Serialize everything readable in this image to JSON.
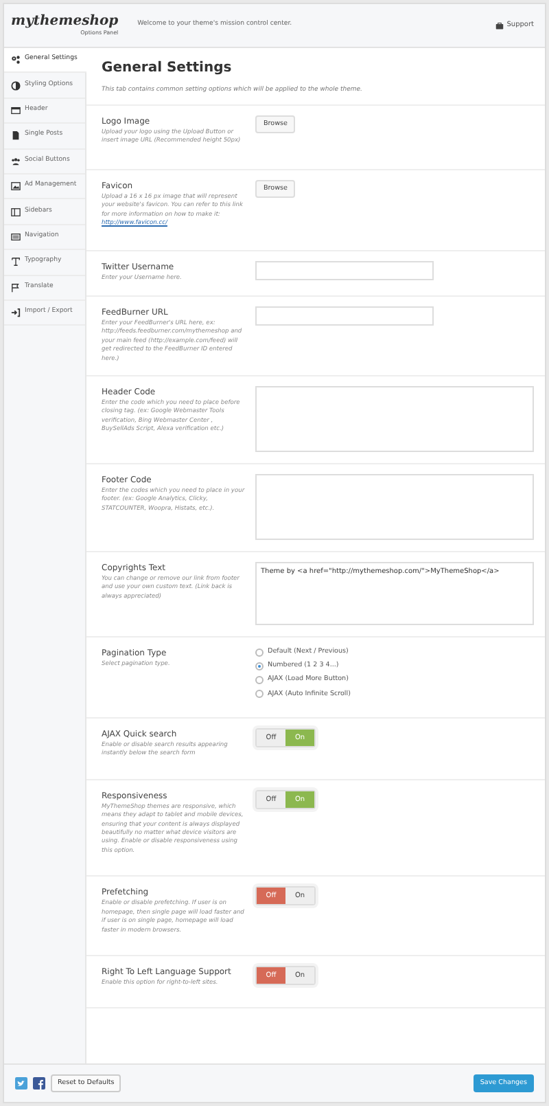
{
  "header": {
    "logo": "mythemeshop",
    "logo_sub": "Options Panel",
    "welcome": "Welcome to your theme's mission control center.",
    "support": "Support"
  },
  "sidebar": {
    "items": [
      {
        "label": "General Settings",
        "selected": true
      },
      {
        "label": "Styling Options",
        "selected": false
      },
      {
        "label": "Header",
        "selected": false
      },
      {
        "label": "Single Posts",
        "selected": false
      },
      {
        "label": "Social Buttons",
        "selected": false
      },
      {
        "label": "Ad Management",
        "selected": false
      },
      {
        "label": "Sidebars",
        "selected": false
      },
      {
        "label": "Navigation",
        "selected": false
      },
      {
        "label": "Typography",
        "selected": false
      },
      {
        "label": "Translate",
        "selected": false
      },
      {
        "label": "Import / Export",
        "selected": false
      }
    ]
  },
  "page": {
    "title": "General Settings",
    "intro": "This tab contains common setting options which will be applied to the whole theme."
  },
  "options": [
    {
      "kind": "upload",
      "label": "Logo Image",
      "description": "Upload your logo using the Upload Button or insert image URL (Recommended height 50px)",
      "button": "Browse"
    },
    {
      "kind": "upload",
      "label": "Favicon",
      "description": "Upload a 16 x 16 px image that will represent your website's favicon. You can refer to this link for more information on how to make it:",
      "link": "http://www.favicon.cc/",
      "button": "Browse"
    },
    {
      "kind": "text",
      "label": "Twitter Username",
      "description": "Enter your Username here."
    },
    {
      "kind": "text",
      "label": "FeedBurner URL",
      "description": "Enter your FeedBurner's URL here, ex: http://feeds.feedburner.com/mythemeshop and your main feed (http://example.com/feed) will get redirected to the FeedBurner ID entered here.)"
    },
    {
      "kind": "textarea",
      "label": "Header Code",
      "description": "Enter the code which you need to place before closing tag. (ex: Google Webmaster Tools verification, Bing Webmaster Center , BuySellAds Script, Alexa verification etc.)"
    },
    {
      "kind": "textarea",
      "label": "Footer Code",
      "description": "Enter the codes which you need to place in your footer. (ex: Google Analytics, Clicky, STATCOUNTER, Woopra, Histats, etc.)."
    },
    {
      "kind": "textarea",
      "label": "Copyrights Text",
      "description": "You can change or remove our link from footer and use your own custom text. (Link back is always appreciated)",
      "value": "Theme by <a href=\"http://mythemeshop.com/\">MyThemeShop</a>"
    },
    {
      "kind": "radio",
      "label": "Pagination Type",
      "description": "Select pagination type.",
      "choices": [
        {
          "label": "Default (Next / Previous)",
          "selected": false
        },
        {
          "label": "Numbered (1 2 3 4...)",
          "selected": true
        },
        {
          "label": "AJAX (Load More Button)",
          "selected": false
        },
        {
          "label": "AJAX (Auto Infinite Scroll)",
          "selected": false
        }
      ]
    },
    {
      "kind": "toggle",
      "label": "AJAX Quick search",
      "description": "Enable or disable search results appearing instantly below the search form",
      "off_label": "Off",
      "on_label": "On",
      "on": true
    },
    {
      "kind": "toggle",
      "label": "Responsiveness",
      "description": "MyThemeShop themes are responsive, which means they adapt to tablet and mobile devices, ensuring that your content is always displayed beautifully no matter what device visitors are using. Enable or disable responsiveness using this option.",
      "off_label": "Off",
      "on_label": "On",
      "on": true
    },
    {
      "kind": "toggle",
      "label": "Prefetching",
      "description": "Enable or disable prefetching. If user is on homepage, then single page will load faster and if user is on single page, homepage will load faster in modern browsers.",
      "off_label": "Off",
      "on_label": "On",
      "on": false
    },
    {
      "kind": "toggle",
      "label": "Right To Left Language Support",
      "description": "Enable this option for right-to-left sites.",
      "off_label": "Off",
      "on_label": "On",
      "on": false
    }
  ],
  "footer": {
    "reset": "Reset to Defaults",
    "save": "Save Changes"
  }
}
